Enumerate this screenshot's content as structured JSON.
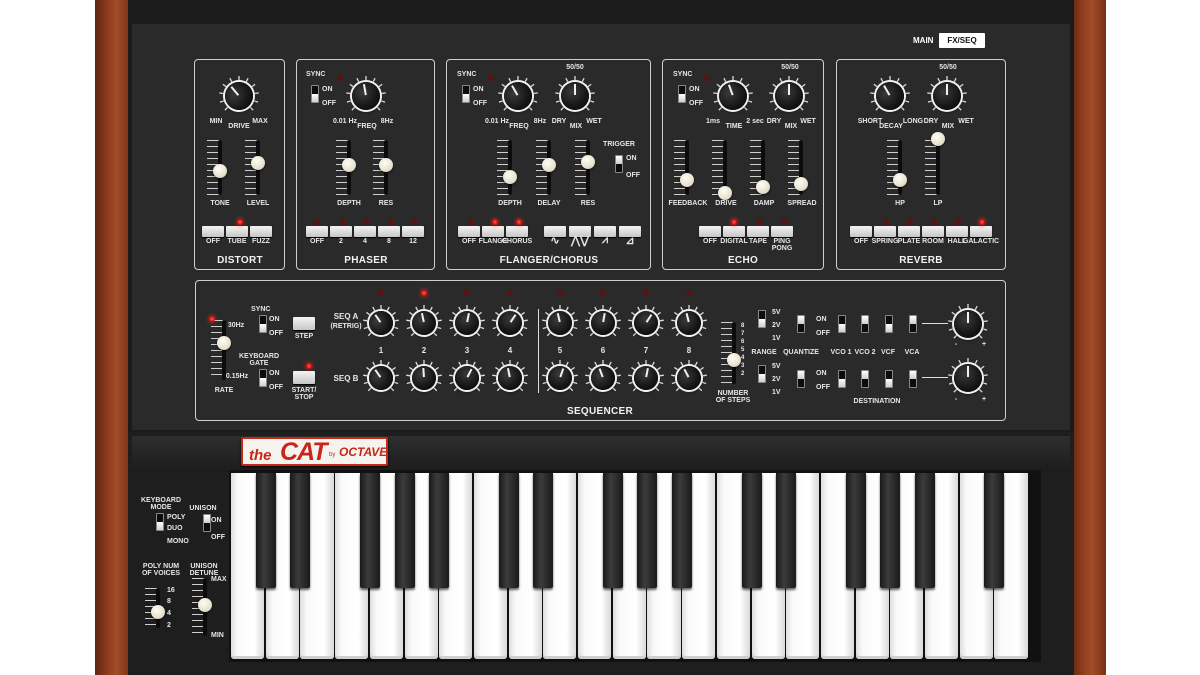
{
  "tabs": {
    "main": "MAIN",
    "fxseq": "FX/SEQ"
  },
  "logo": {
    "the": "the",
    "cat": "CAT",
    "by": "by",
    "octave": "OCTAVE"
  },
  "colors": {
    "panel": "#262728",
    "led_on": "#e00f0f",
    "wood": "#8f3d1e",
    "logo_red": "#c8261a"
  },
  "common": {
    "sync": "SYNC",
    "on": "ON",
    "off": "OFF"
  },
  "distort": {
    "title": "DISTORT",
    "min": "MIN",
    "drive": "DRIVE",
    "max": "MAX",
    "tone": "TONE",
    "level": "LEVEL",
    "buttons": [
      "OFF",
      "TUBE",
      "FUZZ"
    ]
  },
  "phaser": {
    "title": "PHASER",
    "hz_low": "0.01 Hz",
    "freq": "FREQ",
    "hz_high": "8Hz",
    "depth": "DEPTH",
    "res": "RES",
    "buttons": [
      "OFF",
      "2",
      "4",
      "8",
      "12"
    ]
  },
  "flanger": {
    "title": "FLANGER/CHORUS",
    "hz_low": "0.01 Hz",
    "freq": "FREQ",
    "hz_high": "8Hz",
    "ratio": "50/50",
    "dry": "DRY",
    "mix": "MIX",
    "wet": "WET",
    "depth": "DEPTH",
    "delay": "DELAY",
    "res": "RES",
    "trigger": "TRIGGER",
    "buttons": [
      "OFF",
      "FLANGE",
      "CHORUS"
    ],
    "wave_icons": [
      "sine-wave-icon",
      "triangle-wave-icon",
      "saw-up-icon",
      "saw-down-icon"
    ]
  },
  "echo": {
    "title": "ECHO",
    "ms": "1ms",
    "time": "TIME",
    "sec": "2 sec",
    "ratio": "50/50",
    "dry": "DRY",
    "mix": "MIX",
    "wet": "WET",
    "feedback": "FEEDBACK",
    "drive": "DRIVE",
    "damp": "DAMP",
    "spread": "SPREAD",
    "buttons": [
      "OFF",
      "DIGITAL",
      "TAPE",
      "PING\nPONG"
    ]
  },
  "reverb": {
    "title": "REVERB",
    "short": "SHORT",
    "decay": "DECAY",
    "long": "LONG",
    "ratio": "50/50",
    "dry": "DRY",
    "mix": "MIX",
    "wet": "WET",
    "hp": "HP",
    "lp": "LP",
    "buttons": [
      "OFF",
      "SPRING",
      "PLATE",
      "ROOM",
      "HALL",
      "GALACTIC"
    ]
  },
  "sequencer": {
    "title": "SEQUENCER",
    "hz_high": "30Hz",
    "hz_low": "0.15Hz",
    "rate": "RATE",
    "step": "STEP",
    "keyboard_gate": "KEYBOARD\nGATE",
    "start_stop": "START/\nSTOP",
    "seq_a": "SEQ A",
    "retrig": "(RETRIG)",
    "seq_b": "SEQ B",
    "steps": [
      "1",
      "2",
      "3",
      "4",
      "5",
      "6",
      "7",
      "8"
    ],
    "number_of_steps": "NUMBER\nOF STEPS",
    "step_scale": [
      "8",
      "7",
      "6",
      "5",
      "4",
      "3",
      "2"
    ],
    "range": "RANGE",
    "range_values": [
      "5V",
      "2V",
      "1V"
    ],
    "quantize": "QUANTIZE",
    "vco1": "VCO 1",
    "vco2": "VCO 2",
    "vcf": "VCF",
    "vca": "VCA",
    "destination": "DESTINATION",
    "minus": "-",
    "plus": "+"
  },
  "keyboard_panel": {
    "keyboard_mode": "KEYBOARD\nMODE",
    "poly": "POLY",
    "duo": "DUO",
    "mono": "MONO",
    "unison": "UNISON",
    "poly_num": "POLY NUM\nOF VOICES",
    "voices": [
      "16",
      "8",
      "4",
      "2"
    ],
    "unison_detune": "UNISON\nDETUNE",
    "max": "MAX",
    "min": "MIN"
  }
}
